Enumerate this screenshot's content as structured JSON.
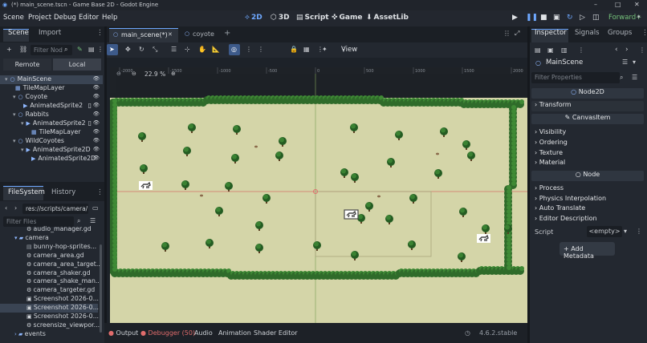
{
  "window": {
    "title": "(*) main_scene.tscn - Game Base 2D - Godot Engine",
    "minimize": "–",
    "maximize": "□",
    "close": "✕"
  },
  "menu": [
    "Scene",
    "Project",
    "Debug",
    "Editor",
    "Help"
  ],
  "workspaces": [
    {
      "label": "2D",
      "glyph": "⟡",
      "active": true
    },
    {
      "label": "3D",
      "glyph": "⬡",
      "active": false
    },
    {
      "label": "Script",
      "glyph": "▤",
      "active": false
    },
    {
      "label": "Game",
      "glyph": "✜",
      "active": false
    },
    {
      "label": "AssetLib",
      "glyph": "⬇",
      "active": false
    }
  ],
  "renderer": "Forward+",
  "scene_dock": {
    "tabs": [
      "Scene",
      "Import"
    ],
    "filter_placeholder": "Filter Nod",
    "remote_label": "Remote",
    "local_label": "Local",
    "nodes": [
      {
        "name": "MainScene",
        "depth": 0,
        "icon": "○",
        "color": "#8fb8ff",
        "selected": true,
        "script": false
      },
      {
        "name": "TileMapLayer",
        "depth": 1,
        "icon": "▦",
        "color": "#8fb8ff",
        "selected": false,
        "script": false
      },
      {
        "name": "Coyote",
        "depth": 1,
        "icon": "○",
        "color": "#8fb8ff",
        "selected": false,
        "script": false
      },
      {
        "name": "AnimatedSprite2",
        "depth": 2,
        "icon": "▶",
        "color": "#8fb8ff",
        "selected": false,
        "script": true
      },
      {
        "name": "Rabbits",
        "depth": 1,
        "icon": "○",
        "color": "#8fb8ff",
        "selected": false,
        "script": false
      },
      {
        "name": "AnimatedSprite2",
        "depth": 2,
        "icon": "▶",
        "color": "#8fb8ff",
        "selected": false,
        "script": true
      },
      {
        "name": "TileMapLayer",
        "depth": 3,
        "icon": "▦",
        "color": "#8fb8ff",
        "selected": false,
        "script": false
      },
      {
        "name": "WildCoyotes",
        "depth": 1,
        "icon": "○",
        "color": "#8fb8ff",
        "selected": false,
        "script": false
      },
      {
        "name": "AnimatedSprite2D",
        "depth": 2,
        "icon": "▶",
        "color": "#8fb8ff",
        "selected": false,
        "script": false
      },
      {
        "name": "AnimatedSprite2D",
        "depth": 3,
        "icon": "▶",
        "color": "#8fb8ff",
        "selected": false,
        "script": false
      }
    ]
  },
  "filesystem_dock": {
    "tabs": [
      "FileSystem",
      "History"
    ],
    "path": "res://scripts/camera/",
    "filter_placeholder": "Filter Files",
    "files": [
      {
        "name": "audio_manager.gd",
        "depth": 2,
        "kind": "gear"
      },
      {
        "name": "camera",
        "depth": 1,
        "kind": "folder"
      },
      {
        "name": "bunny-hop-sprites...",
        "depth": 2,
        "kind": "file"
      },
      {
        "name": "camera_area.gd",
        "depth": 2,
        "kind": "gear"
      },
      {
        "name": "camera_area_target...",
        "depth": 2,
        "kind": "gear"
      },
      {
        "name": "camera_shaker.gd",
        "depth": 2,
        "kind": "gear"
      },
      {
        "name": "camera_shake_man...",
        "depth": 2,
        "kind": "gear"
      },
      {
        "name": "camera_targeter.gd",
        "depth": 2,
        "kind": "gear"
      },
      {
        "name": "Screenshot 2026-0...",
        "depth": 2,
        "kind": "image"
      },
      {
        "name": "Screenshot 2026-0...",
        "depth": 2,
        "kind": "image",
        "selected": true
      },
      {
        "name": "Screenshot 2026-0...",
        "depth": 2,
        "kind": "image"
      },
      {
        "name": "screensize_viewpor...",
        "depth": 2,
        "kind": "gear"
      },
      {
        "name": "events",
        "depth": 1,
        "kind": "folder-collapsed"
      }
    ]
  },
  "editor_tabs": [
    {
      "label": "main_scene(*)",
      "active": true
    },
    {
      "label": "coyote",
      "active": false
    }
  ],
  "viewport_toolbar": {
    "view_label": "View",
    "zoom": "22.9 %",
    "ruler_ticks": [
      "-2000",
      "-1500",
      "-1000",
      "-500",
      "0",
      "500",
      "1000",
      "1500",
      "2000"
    ],
    "ruler_vticks": [
      "0",
      "500"
    ]
  },
  "bottom_panel": {
    "tabs": [
      "Output",
      "Debugger (50)",
      "Audio",
      "Animation",
      "Shader Editor"
    ],
    "version": "4.6.2.stable"
  },
  "inspector": {
    "tabs": [
      "Inspector",
      "Signals",
      "Groups"
    ],
    "node_name": "MainScene",
    "filter_placeholder": "Filter Properties",
    "class_node2d": "Node2D",
    "transform": "Transform",
    "class_canvasitem": "CanvasItem",
    "canvas_props": [
      "Visibility",
      "Ordering",
      "Texture",
      "Material"
    ],
    "class_node": "Node",
    "node_props": [
      "Process",
      "Physics Interpolation",
      "Auto Translate",
      "Editor Description"
    ],
    "script_label": "Script",
    "script_value": "<empty>",
    "add_metadata": "Add Metadata"
  },
  "colors": {
    "accent": "#6ea8ff",
    "grass": "#d4d5a8",
    "hedge": "#2f6b2a",
    "error": "#e06c6c"
  }
}
